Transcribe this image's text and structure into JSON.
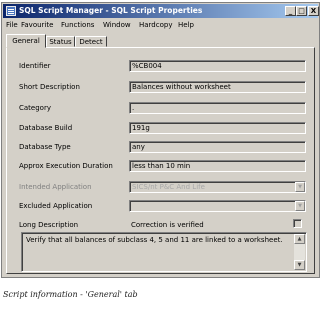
{
  "window": {
    "title": "SQL Script Manager - SQL Script Properties",
    "controls": {
      "minimize": "_",
      "maximize": "□",
      "close": "X"
    }
  },
  "menu": [
    "File",
    "Favourite",
    "Functions",
    "Window",
    "Hardcopy",
    "Help"
  ],
  "tabs": [
    "General",
    "Status",
    "Detect"
  ],
  "active_tab": "General",
  "form": {
    "identifier": {
      "label": "Identifier",
      "value": "%CB004"
    },
    "short_description": {
      "label": "Short Description",
      "value": "Balances without worksheet"
    },
    "category": {
      "label": "Category",
      "value": "."
    },
    "database_build": {
      "label": "Database Build",
      "value": "191g"
    },
    "database_type": {
      "label": "Database Type",
      "value": "any"
    },
    "approx_execution_duration": {
      "label": "Approx Execution Duration",
      "value": "less than 10 min"
    },
    "intended_application": {
      "label": "Intended Application",
      "value": "SICS/nt P&C And Life"
    },
    "excluded_application": {
      "label": "Excluded Application",
      "value": ""
    },
    "long_description": {
      "label": "Long Description",
      "value": "Correction is verified",
      "checked": false
    },
    "notes": "Verify that all balances of subclass 4, 5 and 11 are linked to a worksheet."
  },
  "caption": "Script information - 'General' tab",
  "icons": {
    "combo_arrow": "chevron-down-icon",
    "scroll_up": "scroll-up-icon",
    "scroll_down": "scroll-down-icon"
  }
}
